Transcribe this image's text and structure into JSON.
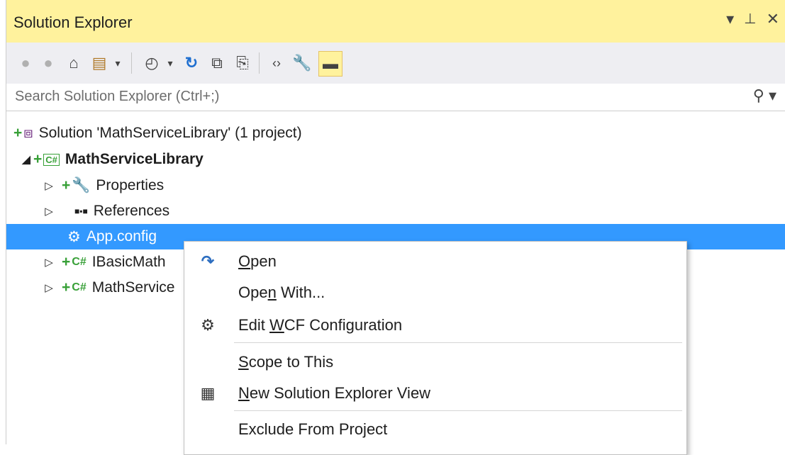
{
  "panel": {
    "title": "Solution Explorer",
    "buttons": {
      "dropdown": "▾",
      "pin": "ᵖ",
      "close": "✕"
    }
  },
  "toolbar": {
    "items": [
      {
        "name": "back-button",
        "glyph": "◀",
        "color": "#b0b0b0"
      },
      {
        "name": "forward-button",
        "glyph": "▶",
        "color": "#b0b0b0"
      },
      {
        "name": "home-button",
        "glyph": "⌂",
        "color": "#424242"
      },
      {
        "name": "switch-views-button",
        "glyph": "▤",
        "color": "#424242"
      },
      {
        "name": "pending-changes-button",
        "glyph": "◴",
        "color": "#424242"
      },
      {
        "name": "sync-button",
        "glyph": "↻",
        "color": "#1f6fd0"
      },
      {
        "name": "collapse-all-button",
        "glyph": "⧉",
        "color": "#424242"
      },
      {
        "name": "show-all-files-button",
        "glyph": "⎘",
        "color": "#424242"
      },
      {
        "name": "view-code-button",
        "glyph": "‹›",
        "color": "#424242"
      },
      {
        "name": "properties-button",
        "glyph": "🔧",
        "color": "#1e1e1e"
      },
      {
        "name": "preview-button",
        "glyph": "▬",
        "color": "#1e1e1e"
      }
    ]
  },
  "search": {
    "placeholder": "Search Solution Explorer (Ctrl+;)"
  },
  "tree": {
    "solution": "Solution 'MathServiceLibrary' (1 project)",
    "project": "MathServiceLibrary",
    "properties": "Properties",
    "references": "References",
    "appconfig": "App.config",
    "ibasic": "IBasicMath",
    "mathservice": "MathService",
    "cs_tag": "C#"
  },
  "menu": {
    "open": {
      "pre": "",
      "u": "O",
      "post": "pen"
    },
    "open_with": {
      "pre": "Ope",
      "u": "n",
      "post": " With..."
    },
    "edit_wcf": {
      "pre": "Edit ",
      "u": "W",
      "post": "CF Configuration"
    },
    "scope": {
      "pre": "",
      "u": "S",
      "post": "cope to This"
    },
    "new_view": {
      "pre": "",
      "u": "N",
      "post": "ew Solution Explorer View"
    },
    "exclude": {
      "pre": "Exclude From Project",
      "u": "",
      "post": ""
    }
  }
}
